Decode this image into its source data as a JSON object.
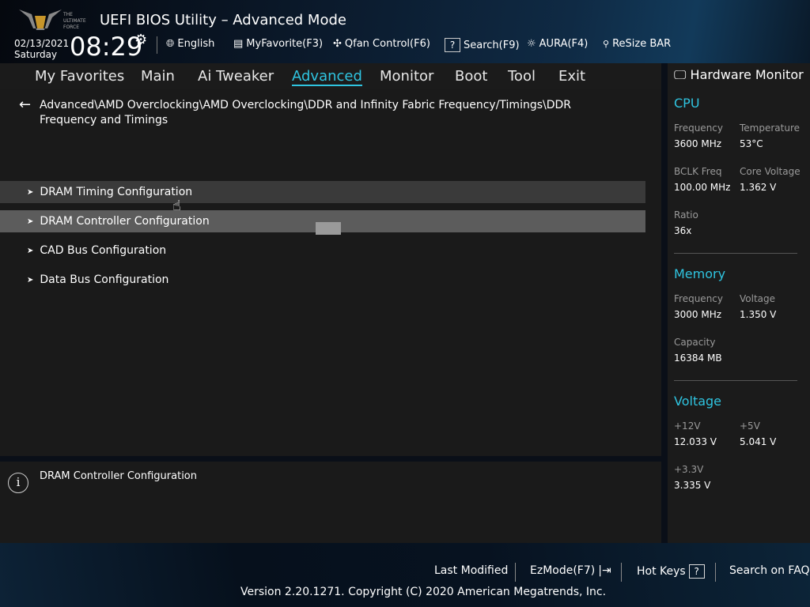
{
  "header": {
    "title": "UEFI BIOS Utility – Advanced Mode",
    "logo_text": "THE ULTIMATE FORCE",
    "date": "02/13/2021",
    "day": "Saturday",
    "time": "08:29",
    "tools": [
      {
        "label": "English",
        "icon": "globe-icon"
      },
      {
        "label": "MyFavorite(F3)",
        "icon": "favorite-icon"
      },
      {
        "label": "Qfan Control(F6)",
        "icon": "fan-icon"
      },
      {
        "label": "Search(F9)",
        "icon": "search-icon"
      },
      {
        "label": "AURA(F4)",
        "icon": "aura-icon"
      },
      {
        "label": "ReSize BAR",
        "icon": "resize-bar-icon"
      }
    ]
  },
  "nav": {
    "tabs": [
      "My Favorites",
      "Main",
      "Ai Tweaker",
      "Advanced",
      "Monitor",
      "Boot",
      "Tool",
      "Exit"
    ],
    "active": "Advanced"
  },
  "breadcrumb": "Advanced\\AMD Overclocking\\AMD Overclocking\\DDR and Infinity Fabric Frequency/Timings\\DDR Frequency and Timings",
  "menu": [
    "DRAM Timing Configuration",
    "DRAM Controller Configuration",
    "CAD Bus Configuration",
    "Data Bus Configuration"
  ],
  "help": "DRAM Controller Configuration",
  "hw": {
    "title": "Hardware Monitor",
    "cpu": {
      "title": "CPU",
      "freq_l": "Frequency",
      "freq": "3600 MHz",
      "temp_l": "Temperature",
      "temp": "53°C",
      "bclk_l": "BCLK Freq",
      "bclk": "100.00 MHz",
      "cv_l": "Core Voltage",
      "cv": "1.362 V",
      "ratio_l": "Ratio",
      "ratio": "36x"
    },
    "mem": {
      "title": "Memory",
      "freq_l": "Frequency",
      "freq": "3000 MHz",
      "volt_l": "Voltage",
      "volt": "1.350 V",
      "cap_l": "Capacity",
      "cap": "16384 MB"
    },
    "volt": {
      "title": "Voltage",
      "v12_l": "+12V",
      "v12": "12.033 V",
      "v5_l": "+5V",
      "v5": "5.041 V",
      "v33_l": "+3.3V",
      "v33": "3.335 V"
    }
  },
  "footer": {
    "last_modified": "Last Modified",
    "ezmode": "EzMode(F7)",
    "hotkeys": "Hot Keys",
    "hotkeys_icon": "?",
    "faq": "Search on FAQ",
    "version": "Version 2.20.1271. Copyright (C) 2020 American Megatrends, Inc."
  },
  "colors": {
    "accent": "#2fc4e0"
  }
}
